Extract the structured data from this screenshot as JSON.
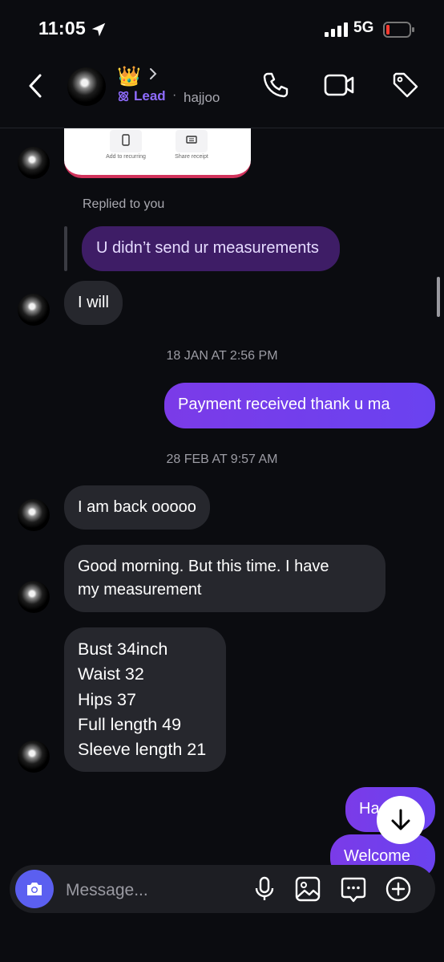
{
  "status_bar": {
    "time": "11:05",
    "network": "5G"
  },
  "header": {
    "crown_emoji": "👑",
    "label": "Lead",
    "separator": "·",
    "username": "hajjoo",
    "accent_color": "#8f6cff"
  },
  "receipt_card": {
    "buttons": [
      {
        "label": "Add to recurring",
        "icon": "phone-icon"
      },
      {
        "label": "Share receipt",
        "icon": "receipt-icon"
      }
    ]
  },
  "thread": {
    "replied_label": "Replied to you",
    "reply_quote": "U didn’t send ur measurements",
    "messages": [
      {
        "id": "m1",
        "direction": "in",
        "text": "I will"
      },
      {
        "id": "d1",
        "type": "date",
        "text": "18 JAN AT 2:56 PM"
      },
      {
        "id": "m2",
        "direction": "out",
        "text": "Payment received thank u ma"
      },
      {
        "id": "d2",
        "type": "date",
        "text": "28 FEB AT 9:57 AM"
      },
      {
        "id": "m3",
        "direction": "in",
        "text": "I am back ooooo"
      },
      {
        "id": "m4",
        "direction": "in",
        "lines": [
          "Good morning. But this time. I have",
          "my measurement"
        ]
      },
      {
        "id": "m5",
        "direction": "in",
        "lines": [
          "Bust 34inch",
          "Waist 32",
          "Hips 37",
          "Full length 49",
          "Sleeve length 21"
        ]
      },
      {
        "id": "m6",
        "direction": "out",
        "text": "Ha"
      },
      {
        "id": "m7",
        "direction": "out",
        "text": "Welcome"
      }
    ]
  },
  "composer": {
    "placeholder": "Message..."
  }
}
